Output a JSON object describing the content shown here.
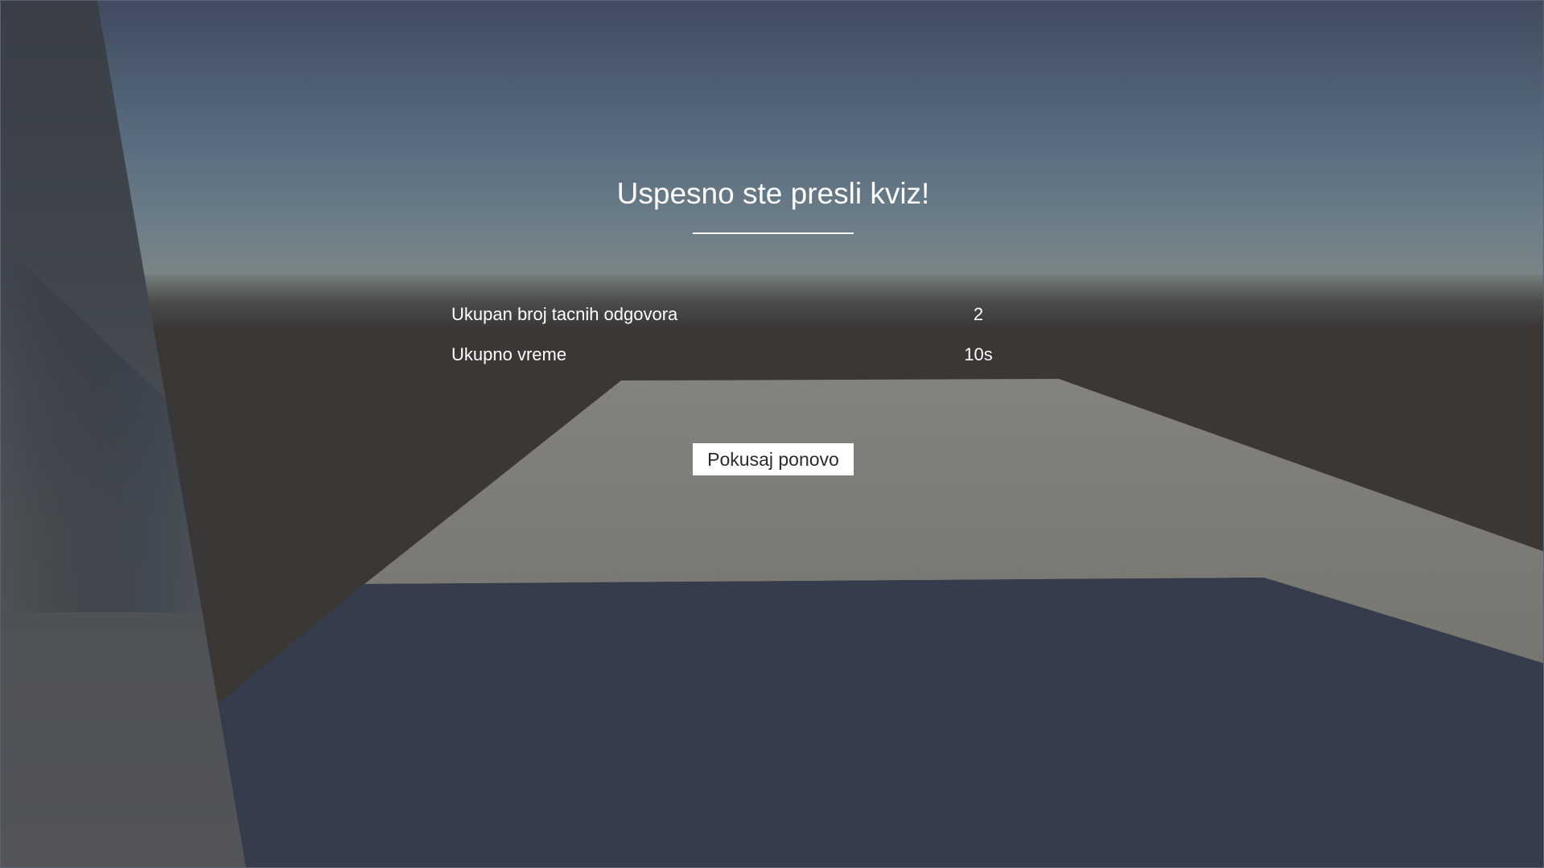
{
  "results": {
    "title": "Uspesno ste presli kviz!",
    "stats": [
      {
        "label": "Ukupan broj tacnih odgovora",
        "value": "2"
      },
      {
        "label": "Ukupno vreme",
        "value": "10s"
      }
    ],
    "retry_label": "Pokusaj ponovo"
  },
  "colors": {
    "text": "#ffffff",
    "button_bg": "#ffffff",
    "button_text": "#2b2b2b",
    "sky_top": "#465a70",
    "horizon": "#7a8684",
    "ground_dark": "#3a3735",
    "floor_light": "#807e78",
    "floor_blue": "#353d4c",
    "pillar": "#4e5256"
  }
}
